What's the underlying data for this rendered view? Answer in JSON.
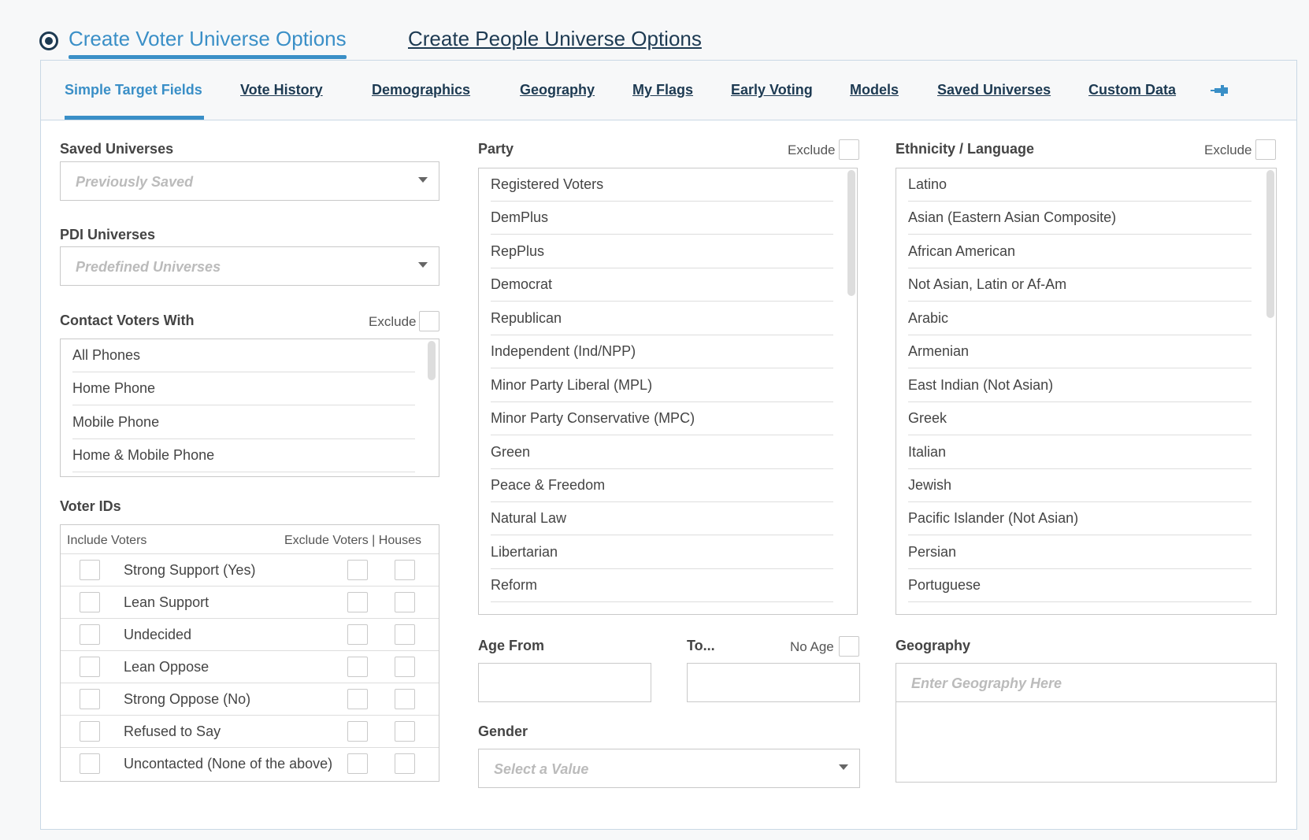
{
  "top_tabs": [
    {
      "label": "Create Voter Universe Options",
      "active": true
    },
    {
      "label": "Create People Universe Options",
      "active": false
    }
  ],
  "sub_tabs": [
    {
      "label": "Simple Target Fields",
      "active": true
    },
    {
      "label": "Vote History"
    },
    {
      "label": "Demographics"
    },
    {
      "label": "Geography"
    },
    {
      "label": "My Flags"
    },
    {
      "label": "Early Voting"
    },
    {
      "label": "Models"
    },
    {
      "label": "Saved Universes"
    },
    {
      "label": "Custom Data"
    }
  ],
  "pin_icon": "pin-icon",
  "saved_universes": {
    "label": "Saved Universes",
    "placeholder": "Previously Saved"
  },
  "pdi_universes": {
    "label": "PDI Universes",
    "placeholder": "Predefined Universes"
  },
  "contact_voters": {
    "label": "Contact Voters With",
    "exclude_label": "Exclude",
    "items": [
      "All Phones",
      "Home Phone",
      "Mobile Phone",
      "Home & Mobile Phone"
    ]
  },
  "voter_ids": {
    "label": "Voter IDs",
    "include_header": "Include Voters",
    "exclude_header": "Exclude Voters | Houses",
    "rows": [
      "Strong Support (Yes)",
      "Lean Support",
      "Undecided",
      "Lean Oppose",
      "Strong Oppose (No)",
      "Refused to Say",
      "Uncontacted (None of the above)"
    ]
  },
  "party": {
    "label": "Party",
    "exclude_label": "Exclude",
    "items": [
      "Registered Voters",
      "DemPlus",
      "RepPlus",
      "Democrat",
      "Republican",
      "Independent (Ind/NPP)",
      "Minor Party Liberal (MPL)",
      "Minor Party Conservative (MPC)",
      "Green",
      "Peace & Freedom",
      "Natural Law",
      "Libertarian",
      "Reform"
    ]
  },
  "ethnicity": {
    "label": "Ethnicity / Language",
    "exclude_label": "Exclude",
    "items": [
      "Latino",
      "Asian (Eastern Asian Composite)",
      "African American",
      "Not Asian, Latin or Af-Am",
      "Arabic",
      "Armenian",
      "East Indian (Not Asian)",
      "Greek",
      "Italian",
      "Jewish",
      "Pacific Islander (Not Asian)",
      "Persian",
      "Portuguese"
    ]
  },
  "age": {
    "from_label": "Age From",
    "to_label": "To...",
    "no_age_label": "No Age"
  },
  "gender": {
    "label": "Gender",
    "placeholder": "Select a Value"
  },
  "geography": {
    "label": "Geography",
    "placeholder": "Enter Geography Here"
  }
}
